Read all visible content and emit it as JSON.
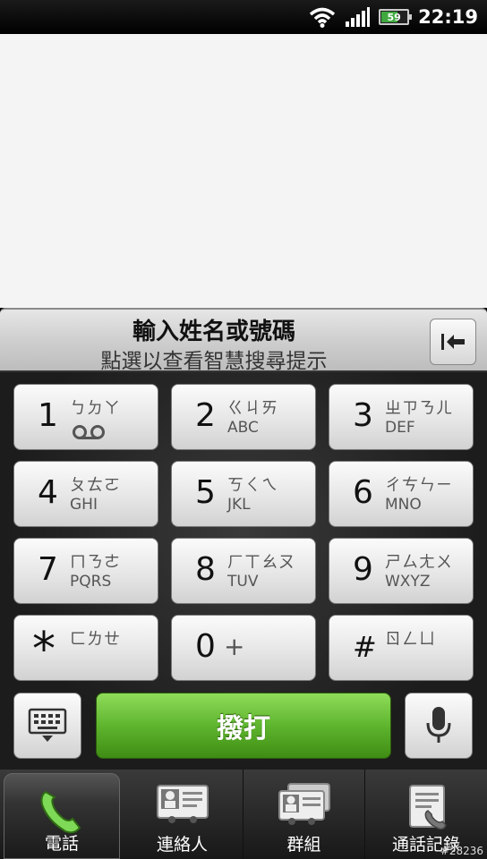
{
  "status": {
    "time": "22:19",
    "battery": "59"
  },
  "hint": {
    "title": "輸入姓名或號碼",
    "subtitle": "點選以查看智慧搜尋提示"
  },
  "keys": [
    {
      "digit": "1",
      "zhuyin": "ㄅㄉㄚ",
      "letters": ""
    },
    {
      "digit": "2",
      "zhuyin": "ㄍㄐㄞ",
      "letters": "ABC"
    },
    {
      "digit": "3",
      "zhuyin": "ㄓㄗㄋㄦ",
      "letters": "DEF"
    },
    {
      "digit": "4",
      "zhuyin": "ㄆㄊㄛ",
      "letters": "GHI"
    },
    {
      "digit": "5",
      "zhuyin": "ㄎㄑㄟ",
      "letters": "JKL"
    },
    {
      "digit": "6",
      "zhuyin": "ㄔㄘㄣㄧ",
      "letters": "MNO"
    },
    {
      "digit": "7",
      "zhuyin": "ㄇㄋㄜ",
      "letters": "PQRS"
    },
    {
      "digit": "8",
      "zhuyin": "ㄏㄒㄠㄡ",
      "letters": "TUV"
    },
    {
      "digit": "9",
      "zhuyin": "ㄕㄙㄤㄨ",
      "letters": "WXYZ"
    },
    {
      "digit": "*",
      "zhuyin": "ㄈㄌㄝ",
      "letters": ""
    },
    {
      "digit": "0",
      "zhuyin": "+",
      "letters": ""
    },
    {
      "digit": "#",
      "zhuyin": "ㄖㄥㄩ",
      "letters": ""
    }
  ],
  "call": {
    "label": "撥打"
  },
  "tabs": [
    {
      "label": "電話",
      "icon": "phone-icon"
    },
    {
      "label": "連絡人",
      "icon": "contact-card-icon"
    },
    {
      "label": "群組",
      "icon": "group-cards-icon"
    },
    {
      "label": "通話記錄",
      "icon": "call-log-icon"
    }
  ],
  "watermark": "#28236",
  "colors": {
    "call_green": "#5fb52e",
    "wifi": "#ffffff",
    "battery_fill": "#3fa93f"
  }
}
